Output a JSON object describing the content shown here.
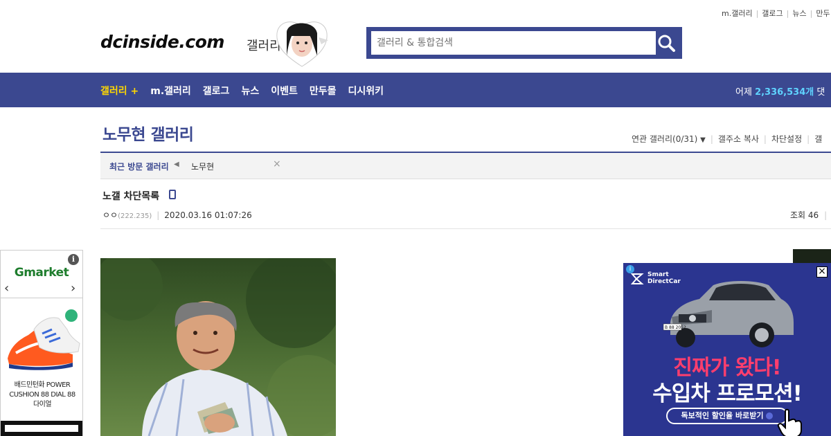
{
  "header": {
    "top_links": [
      "m.갤러리",
      "갤로그",
      "뉴스",
      "만두"
    ],
    "logo": "dcinside.com",
    "logo_sub": "갤러리",
    "search_placeholder": "갤러리 & 통합검색"
  },
  "gnb": {
    "menu": [
      "갤러리 +",
      "m.갤러리",
      "갤로그",
      "뉴스",
      "이벤트",
      "만두몰",
      "디시위키"
    ],
    "stat_label": "어제",
    "stat_value": "2,336,534개",
    "stat_suffix": "댓"
  },
  "gallery": {
    "title": "노무현 갤러리",
    "tools": [
      "연관 갤러리(0/31)",
      "갤주소 복사",
      "차단설정",
      "갤"
    ],
    "recent_label": "최근 방문 갤러리",
    "recent_item": "노무현",
    "recent_close": "×"
  },
  "post": {
    "title": "노갤 차단목록",
    "author": "ㅇㅇ",
    "ip": "(222.235)",
    "date": "2020.03.16 01:07:26",
    "views": "조회 46"
  },
  "ad_left": {
    "brand": "Gmarket",
    "info": "i",
    "product": "배드민턴화 POWER CUSHION 88 DIAL 88 다이얼"
  },
  "ad_right": {
    "badge": "i",
    "brand_line1": "Smart",
    "brand_line2": "DirectCar",
    "plate": "B 88 2052",
    "headline1": "진짜가 왔다!",
    "headline2": "수입차 프로모션!",
    "cta": "독보적인 할인율 바로받기",
    "close": "×"
  },
  "colors": {
    "brand_blue": "#3b4890",
    "active_menu": "#ffd800",
    "stat_number": "#5fd3ff",
    "ad_pink": "#ff3e6d"
  }
}
